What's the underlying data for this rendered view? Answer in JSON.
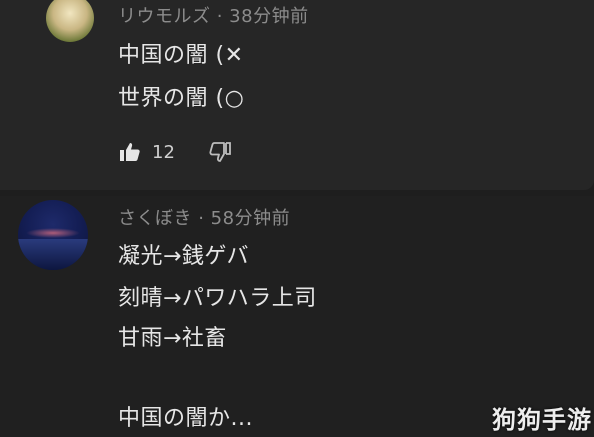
{
  "comments": [
    {
      "author": "リウモルズ",
      "time": "38分钟前",
      "lines": [
        "中国の闇 (✕",
        "世界の闇 (○"
      ],
      "like_count": "12"
    },
    {
      "author": "さくぼき",
      "time": "58分钟前",
      "lines": [
        "凝光→銭ゲバ",
        "刻晴→パワハラ上司",
        "甘雨→社畜",
        "中国の闇か..."
      ]
    }
  ],
  "separator": " · ",
  "watermark": "狗狗手游"
}
